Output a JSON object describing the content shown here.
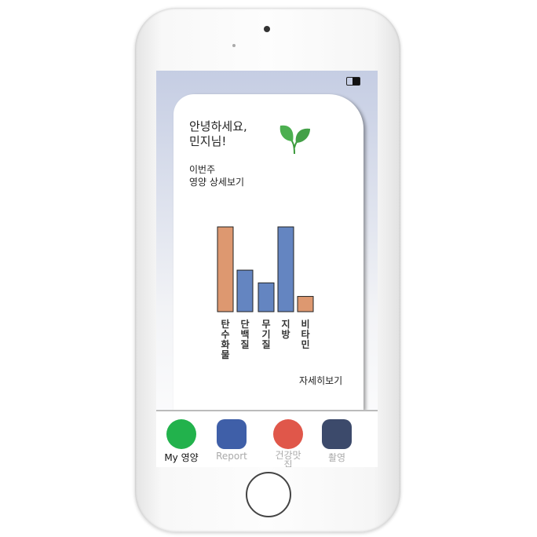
{
  "greeting": {
    "line1": "안녕하세요,",
    "line2": "민지님!"
  },
  "subtitle": {
    "line1": "이번주",
    "line2": "영양 상세보기"
  },
  "details_link": "자세히보기",
  "chart_data": {
    "type": "bar",
    "categories": [
      "탄수화물",
      "단백질",
      "무기질",
      "지방",
      "비타민"
    ],
    "values": [
      100,
      49,
      34,
      100,
      18
    ],
    "colors": [
      "#dd9870",
      "#6485c1",
      "#6485c1",
      "#6485c1",
      "#dd9870"
    ],
    "grid": false,
    "ylim": [
      0,
      100
    ]
  },
  "nav": {
    "items": [
      {
        "label": "My 영양",
        "icon": "lemon-icon",
        "color": "#22b24c"
      },
      {
        "label": "Report",
        "icon": "report-icon",
        "color": "#3f5fa8"
      },
      {
        "label": "건강맛집",
        "icon": "dish-icon",
        "color": "#e0574a"
      },
      {
        "label": "촬영",
        "icon": "camera-icon",
        "color": "#3c4a6b"
      }
    ]
  }
}
